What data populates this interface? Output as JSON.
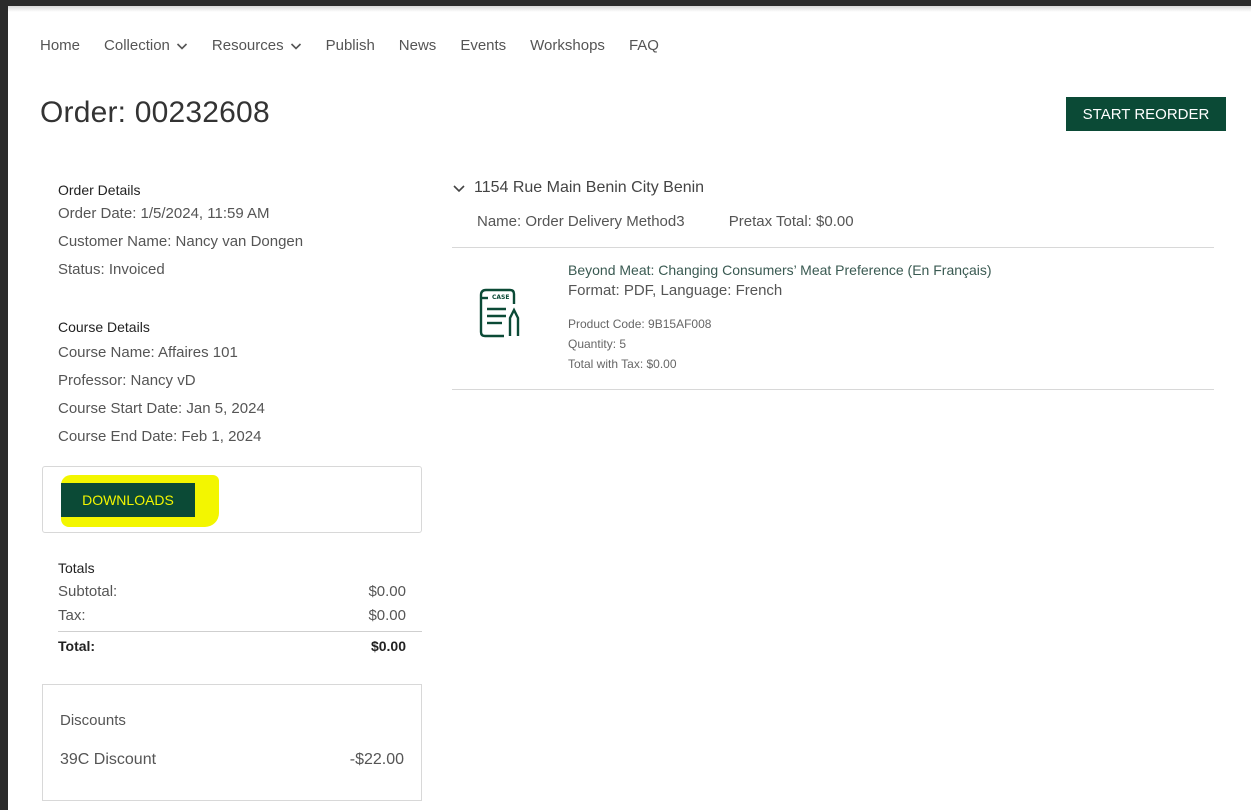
{
  "nav": {
    "items": [
      {
        "label": "Home",
        "dropdown": false
      },
      {
        "label": "Collection",
        "dropdown": true
      },
      {
        "label": "Resources",
        "dropdown": true
      },
      {
        "label": "Publish",
        "dropdown": false
      },
      {
        "label": "News",
        "dropdown": false
      },
      {
        "label": "Events",
        "dropdown": false
      },
      {
        "label": "Workshops",
        "dropdown": false
      },
      {
        "label": "FAQ",
        "dropdown": false
      }
    ]
  },
  "page": {
    "title": "Order: 00232608",
    "reorder_label": "START REORDER"
  },
  "order_details": {
    "heading": "Order Details",
    "order_date": "Order Date: 1/5/2024, 11:59 AM",
    "customer_name": "Customer Name: Nancy van Dongen",
    "status": "Status: Invoiced"
  },
  "course_details": {
    "heading": "Course Details",
    "course_name": "Course Name: Affaires 101",
    "professor": "Professor: Nancy vD",
    "start_date": "Course Start Date: Jan 5, 2024",
    "end_date": "Course End Date: Feb 1, 2024"
  },
  "downloads": {
    "label": "DOWNLOADS",
    "highlight_color": "#f3f600"
  },
  "totals": {
    "heading": "Totals",
    "subtotal_label": "Subtotal:",
    "subtotal_value": "$0.00",
    "tax_label": "Tax:",
    "tax_value": "$0.00",
    "total_label": "Total:",
    "total_value": "$0.00"
  },
  "discounts": {
    "heading": "Discounts",
    "name": "39C Discount",
    "amount": "-$22.00"
  },
  "shipment": {
    "address": "1154 Rue Main Benin City Benin",
    "name": "Name: Order Delivery Method3",
    "pretax_total": "Pretax Total: $0.00"
  },
  "product": {
    "icon": "case-document-icon",
    "icon_label": "CASE",
    "title": "Beyond Meat: Changing Consumers’ Meat Preference (En Français)",
    "format": "Format: PDF, Language: French",
    "product_code": "Product Code: 9B15AF008",
    "quantity": "Quantity: 5",
    "total_with_tax": "Total with Tax: $0.00"
  },
  "colors": {
    "brand_green": "#0b4a36",
    "highlight_yellow": "#f3f600"
  }
}
